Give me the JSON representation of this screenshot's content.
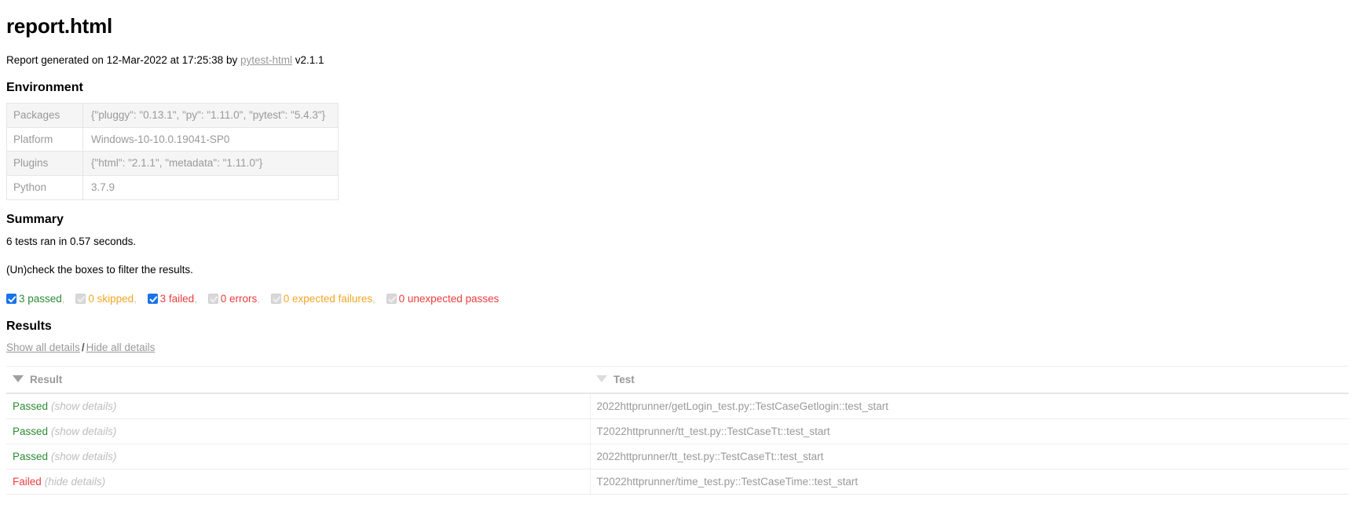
{
  "report": {
    "title": "report.html",
    "generated_prefix": "Report generated on ",
    "generated_datetime": "12-Mar-2022 at 17:25:38",
    "generated_by": " by ",
    "generator_link": "pytest-html",
    "generator_version": " v2.1.1"
  },
  "environment": {
    "heading": "Environment",
    "rows": [
      {
        "key": "Packages",
        "value": "{\"pluggy\": \"0.13.1\", \"py\": \"1.11.0\", \"pytest\": \"5.4.3\"}"
      },
      {
        "key": "Platform",
        "value": "Windows-10-10.0.19041-SP0"
      },
      {
        "key": "Plugins",
        "value": "{\"html\": \"2.1.1\", \"metadata\": \"1.11.0\"}"
      },
      {
        "key": "Python",
        "value": "3.7.9"
      }
    ]
  },
  "summary": {
    "heading": "Summary",
    "run_line": "6 tests ran in 0.57 seconds.",
    "filter_hint": "(Un)check the boxes to filter the results.",
    "filters": [
      {
        "label": "3 passed",
        "checked": true,
        "kind": "passed",
        "trailing": ","
      },
      {
        "label": "0 skipped",
        "checked": false,
        "kind": "skipped",
        "trailing": ","
      },
      {
        "label": "3 failed",
        "checked": true,
        "kind": "failed",
        "trailing": ","
      },
      {
        "label": "0 errors",
        "checked": false,
        "kind": "error",
        "trailing": ","
      },
      {
        "label": "0 expected failures",
        "checked": false,
        "kind": "xfailed",
        "trailing": ","
      },
      {
        "label": "0 unexpected passes",
        "checked": false,
        "kind": "xpassed",
        "trailing": ""
      }
    ]
  },
  "results": {
    "heading": "Results",
    "show_all": "Show all details",
    "separator": "/",
    "hide_all": "Hide all details",
    "columns": [
      {
        "label": "Result",
        "sorted": true
      },
      {
        "label": "Test",
        "sorted": false
      }
    ],
    "rows": [
      {
        "outcome": "Passed",
        "kind": "passed",
        "details_label": "(show details)",
        "test": "2022httprunner/getLogin_test.py::TestCaseGetlogin::test_start"
      },
      {
        "outcome": "Passed",
        "kind": "passed",
        "details_label": "(show details)",
        "test": "T2022httprunner/tt_test.py::TestCaseTt::test_start"
      },
      {
        "outcome": "Passed",
        "kind": "passed",
        "details_label": "(show details)",
        "test": "2022httprunner/tt_test.py::TestCaseTt::test_start"
      },
      {
        "outcome": "Failed",
        "kind": "failed",
        "details_label": "(hide details)",
        "test": "T2022httprunner/time_test.py::TestCaseTime::test_start"
      }
    ]
  },
  "colors": {
    "passed": "#2e8b36",
    "failed": "#eb3d3d",
    "skipped": "#f5a623",
    "checkbox_checked": "#1a73e8",
    "muted": "#999999"
  }
}
